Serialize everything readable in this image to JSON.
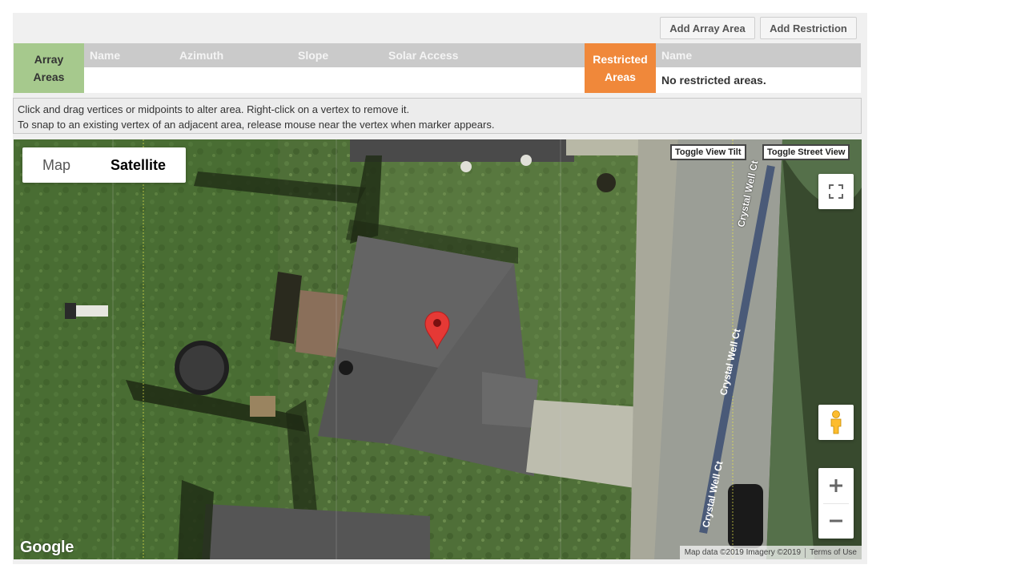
{
  "toolbar": {
    "add_array_area": "Add Array Area",
    "add_restriction": "Add Restriction"
  },
  "array_areas": {
    "header": "Array Areas",
    "columns": [
      "Name",
      "Azimuth",
      "Slope",
      "Solar Access"
    ],
    "color": "#a6c98d"
  },
  "restricted_areas": {
    "header": "Restricted Areas",
    "column": "Name",
    "empty_text": "No restricted areas.",
    "color": "#f0883a"
  },
  "instructions": {
    "line1": "Click and drag vertices or midpoints to alter area. Right-click on a vertex to remove it.",
    "line2": "To snap to an existing vertex of an adjacent area, release mouse near the vertex when marker appears."
  },
  "map": {
    "map_type_options": [
      "Map",
      "Satellite"
    ],
    "selected_map_type": "Satellite",
    "toggle_view_tilt": "Toggle View Tilt",
    "toggle_street_view": "Toggle Street View",
    "logo": "Google",
    "attribution": "Map data ©2019 Imagery ©2019",
    "terms": "Terms of Use",
    "street_label": "Crystal Well Ct",
    "icons": [
      "fullscreen-icon",
      "pegman-icon",
      "zoom-in-icon",
      "zoom-out-icon",
      "map-marker-icon"
    ],
    "marker_color": "#e53935"
  }
}
